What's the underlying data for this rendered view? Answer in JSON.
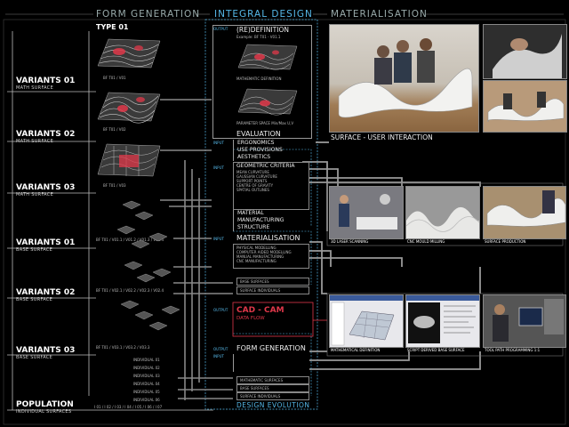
{
  "headers": {
    "form_generation": "FORM GENERATION",
    "integral_design": "INTEGRAL DESIGN",
    "materialisation": "MATERIALISATION"
  },
  "left": {
    "type": "TYPE 01",
    "variants": [
      {
        "title": "VARIANTS 01",
        "sub": "MATH SURFACE"
      },
      {
        "title": "VARIANTS 02",
        "sub": "MATH SURFACE"
      },
      {
        "title": "VARIANTS 03",
        "sub": "MATH SURFACE"
      },
      {
        "title": "VARIANTS 01",
        "sub": "BASE SURFACE"
      },
      {
        "title": "VARIANTS 02",
        "sub": "BASE SURFACE"
      },
      {
        "title": "VARIANTS 03",
        "sub": "BASE SURFACE"
      }
    ],
    "population": {
      "title": "POPULATION",
      "sub": "INDIVIDUAL SURFACES"
    },
    "flow_labels": [
      "BF T01 / V01",
      "BF T01 / V02",
      "BF T01 / V03",
      "BF T01 / V01.1 / V01.2 / V01.3 / V01.4",
      "BF T01 / V02.1 / V02.2 / V02.3 / V02.4",
      "BF T01 / V03.1 / V03.2 / V03.3"
    ],
    "individuals": [
      "INDIVIDUAL 01",
      "INDIVIDUAL 02",
      "INDIVIDUAL 03",
      "INDIVIDUAL 04",
      "INDIVIDUAL 05",
      "INDIVIDUAL 06"
    ],
    "population_row": "I 01 / I 02 / I 03 / I 04 / I 05 / I 06 / I 07"
  },
  "middle": {
    "redefinition": "(RE)DEFINITION",
    "example": "Example: BF T01 - V01.1",
    "math_def": "MATHEMATIC DEFINITION",
    "param_space": "PARAMETER SPACE Min/Max U,V",
    "evaluation": "EVALUATION",
    "eval_items": [
      "ERGONOMICS",
      "USE PROVISIONS",
      "AESTHETICS"
    ],
    "geometric": "GEOMETRIC CRITERIA",
    "geo_items": [
      "MEAN CURVATURE",
      "GAUSSIAN CURVATURE",
      "SUPPORT POINTS",
      "CENTRE OF GRAVITY",
      "SPATIAL OUTLINES"
    ],
    "mat_items": [
      "MATERIAL",
      "MANUFACTURING",
      "STRUCTURE"
    ],
    "materialisation": "MATERIALISATION",
    "mat2_items": [
      "PHYSICAL MODELLING",
      "COMPUTER AIDED MODELLING",
      "MANUAL MANUFACTURING",
      "CNC MANUFACTURING"
    ],
    "base_surfaces": "BASE SURFACES",
    "surface_individuals": "SURFACE INDIVIDUALS",
    "cadcam": "CAD - CAM",
    "dataflow": "DATA FLOW",
    "form_generation": "FORM GENERATION",
    "mathematic_surfaces": "MATHEMATIC SURFACES",
    "base_surfaces2": "BASE SURFACES",
    "surface_individuals2": "SURFACE INDIVIDUALS",
    "design_evolution": "DESIGN EVOLUTION",
    "side_labels": [
      "OUTPUT",
      "INPUT",
      "INPUT",
      "INPUT",
      "OUTPUT",
      "OUTPUT",
      "INPUT"
    ]
  },
  "right": {
    "surface_user": "SURFACE - USER INTERACTION",
    "captions": [
      "3D LASER SCANNING",
      "CNC MOULD MILLING",
      "SURFACE PRODUCTION",
      "MATHEMATICAL DEFINITION",
      "SCRIPT DERIVED BASE SURFACE",
      "TOOL PATH PROGRAMMING 1:1"
    ]
  }
}
